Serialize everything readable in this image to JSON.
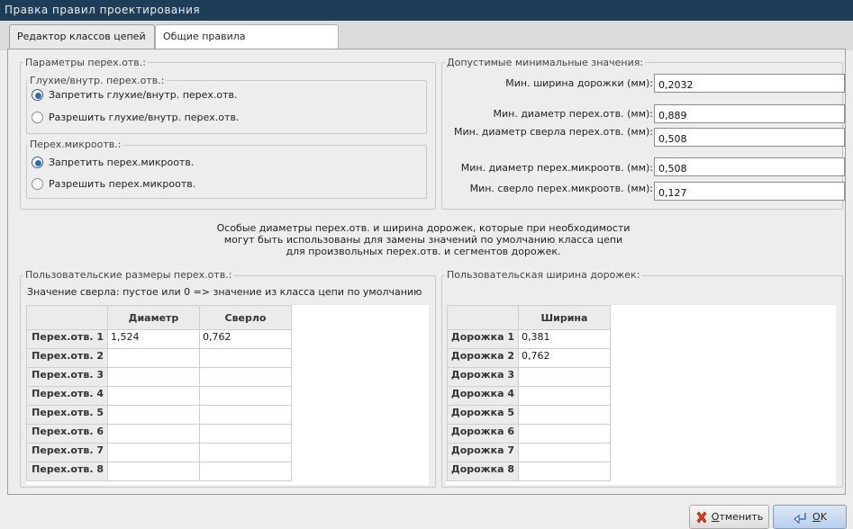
{
  "window": {
    "title": "Правка правил проектирования"
  },
  "tabs": [
    {
      "label": "Редактор классов цепей"
    },
    {
      "label": "Общие правила проектирования"
    }
  ],
  "via_params": {
    "legend": "Параметры перех.отв.:",
    "blind": {
      "legend": "Глухие/внутр. перех.отв.:",
      "options": [
        "Запретить глухие/внутр. перех.отв.",
        "Разрешить глухие/внутр. перех.отв."
      ],
      "selected": 0
    },
    "micro": {
      "legend": "Перех.микроотв.:",
      "options": [
        "Запретить перех.микроотв.",
        "Разрешить перех.микроотв."
      ],
      "selected": 0
    }
  },
  "min_values": {
    "legend": "Допустимые минимальные значения:",
    "fields": [
      {
        "label": "Мин. ширина дорожки (мм):",
        "value": "0,2032"
      },
      {
        "label": "Мин. диаметр перех.отв. (мм):",
        "value": "0,889"
      },
      {
        "label": "Мин. диаметр сверла перех.отв. (мм):",
        "value": "0,508"
      },
      {
        "label": "Мин. диаметр перех.микроотв. (мм):",
        "value": "0,508"
      },
      {
        "label": "Мин. сверло перех.микроотв. (мм):",
        "value": "0,127"
      }
    ]
  },
  "info_text": {
    "line1": "Особые диаметры перех.отв. и ширина дорожек, которые при необходимости",
    "line2": "могут быть использованы для замены значений по умолчанию класса цепи",
    "line3": "для произвольных перех.отв. и сегментов дорожек."
  },
  "custom_vias": {
    "legend": "Пользовательские размеры перех.отв.:",
    "hint": "Значение сверла: пустое или 0 => значение из класса цепи по умолчанию",
    "columns": [
      "Диаметр",
      "Сверло"
    ],
    "rows": [
      {
        "label": "Перех.отв. 1",
        "diameter": "1,524",
        "drill": "0,762"
      },
      {
        "label": "Перех.отв. 2",
        "diameter": "",
        "drill": ""
      },
      {
        "label": "Перех.отв. 3",
        "diameter": "",
        "drill": ""
      },
      {
        "label": "Перех.отв. 4",
        "diameter": "",
        "drill": ""
      },
      {
        "label": "Перех.отв. 5",
        "diameter": "",
        "drill": ""
      },
      {
        "label": "Перех.отв. 6",
        "diameter": "",
        "drill": ""
      },
      {
        "label": "Перех.отв. 7",
        "diameter": "",
        "drill": ""
      },
      {
        "label": "Перех.отв. 8",
        "diameter": "",
        "drill": ""
      }
    ]
  },
  "custom_tracks": {
    "legend": "Пользовательская ширина дорожек:",
    "columns": [
      "Ширина"
    ],
    "rows": [
      {
        "label": "Дорожка 1",
        "width": "0,381"
      },
      {
        "label": "Дорожка 2",
        "width": "0,762"
      },
      {
        "label": "Дорожка 3",
        "width": ""
      },
      {
        "label": "Дорожка 4",
        "width": ""
      },
      {
        "label": "Дорожка 5",
        "width": ""
      },
      {
        "label": "Дорожка 6",
        "width": ""
      },
      {
        "label": "Дорожка 7",
        "width": ""
      },
      {
        "label": "Дорожка 8",
        "width": ""
      }
    ]
  },
  "buttons": {
    "cancel": {
      "mnemonic": "О",
      "rest": "тменить"
    },
    "ok": {
      "mnemonic": "O",
      "rest": "K"
    }
  },
  "colors": {
    "titlebar": "#1f3d56",
    "radio_selected": "#2e6db4",
    "cancel_icon": "#d93a1a",
    "ok_icon": "#3a6fb3"
  },
  "icons": {
    "cancel": "red-x-icon",
    "ok": "enter-arrow-icon"
  }
}
